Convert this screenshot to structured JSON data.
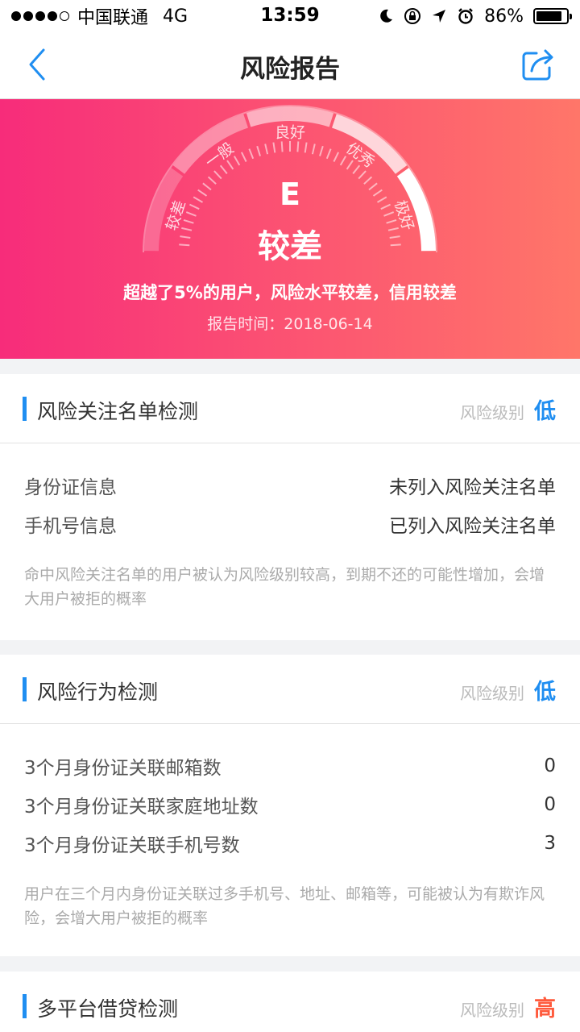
{
  "status_bar": {
    "carrier": "中国联通",
    "network": "4G",
    "time": "13:59",
    "battery": "86%",
    "battery_level": 0.86
  },
  "nav": {
    "back_icon": "chevron-left-icon",
    "title": "风险报告",
    "share_icon": "share-icon"
  },
  "hero": {
    "gauge_labels": [
      "较差",
      "一般",
      "良好",
      "优秀",
      "极好"
    ],
    "grade": "E",
    "level": "较差",
    "summary": "超越了5%的用户，风险水平较差，信用较差",
    "report_time": "报告时间：2018-06-14"
  },
  "sections": [
    {
      "title": "风险关注名单检测",
      "level_label": "风险级别",
      "level_value": "低",
      "rows": [
        {
          "label": "身份证信息",
          "value": "未列入风险关注名单"
        },
        {
          "label": "手机号信息",
          "value": "已列入风险关注名单"
        }
      ],
      "note": "命中风险关注名单的用户被认为风险级别较高，到期不还的可能性增加，会增大用户被拒的概率"
    },
    {
      "title": "风险行为检测",
      "level_label": "风险级别",
      "level_value": "低",
      "rows": [
        {
          "label": "3个月身份证关联邮箱数",
          "value": "0"
        },
        {
          "label": "3个月身份证关联家庭地址数",
          "value": "0"
        },
        {
          "label": "3个月身份证关联手机号数",
          "value": "3"
        }
      ],
      "note": "用户在三个月内身份证关联过多手机号、地址、邮箱等，可能被认为有欺诈风险，会增大用户被拒的概率"
    },
    {
      "title": "多平台借贷检测",
      "level_label": "风险级别",
      "level_value": "高"
    }
  ],
  "colors": {
    "accent_blue": "#1f8ef1",
    "high_risk": "#ff5a3c",
    "hero_start": "#f72c7a",
    "hero_end": "#ff7669"
  }
}
